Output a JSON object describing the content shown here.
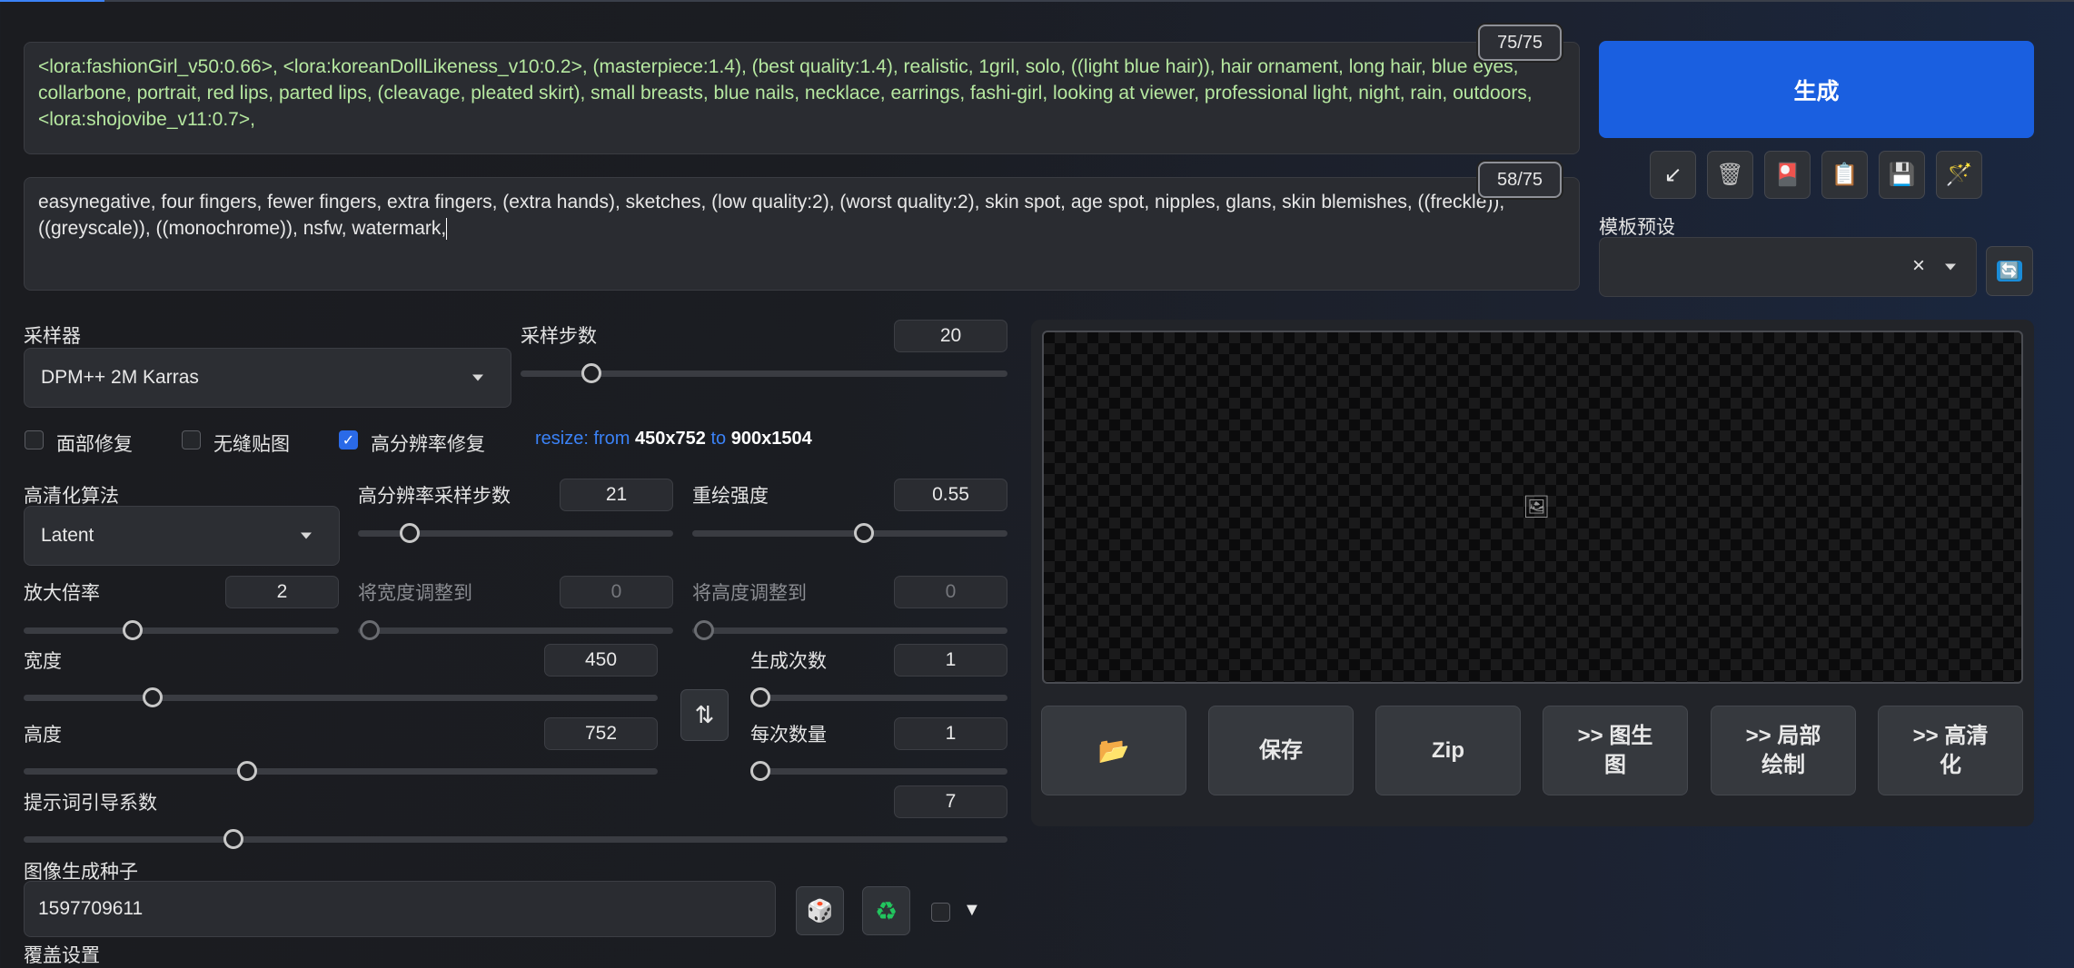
{
  "prompts": {
    "positive": "<lora:fashionGirl_v50:0.66>, <lora:koreanDollLikeness_v10:0.2>, (masterpiece:1.4), (best quality:1.4), realistic, 1gril, solo, ((light blue hair)), hair ornament, long hair, blue eyes, collarbone, portrait, red lips, parted lips, (cleavage, pleated skirt), small breasts, blue nails, necklace, earrings, fashi-girl, looking at viewer, professional light, night, rain, outdoors, <lora:shojovibe_v11:0.7>,",
    "positive_counter": "75/75",
    "negative": "easynegative, four fingers, fewer fingers, extra fingers, (extra hands), sketches, (low quality:2), (worst quality:2), skin spot, age spot, nipples, glans, skin blemishes, ((freckle)), ((greyscale)), ((monochrome)), nsfw, watermark,",
    "negative_counter": "58/75"
  },
  "generate": {
    "label": "生成",
    "tools": [
      "arrow-icon",
      "trash-icon",
      "card-icon",
      "clipboard-icon",
      "save-disk-icon",
      "magic-wand-icon"
    ],
    "tool_glyphs": [
      "↙",
      "🗑",
      "🎴",
      "📋",
      "💾",
      "🪄"
    ],
    "styles_label": "模板预设",
    "styles_clear": "×",
    "refresh_glyph": "🔄"
  },
  "sampler": {
    "label": "采样器",
    "value": "DPM++ 2M Karras",
    "steps_label": "采样步数",
    "steps": "20",
    "steps_fraction": 0.13
  },
  "options": {
    "face_restore": "面部修复",
    "tiling": "无缝贴图",
    "hires_fix": "高分辨率修复",
    "hires_checked": "✓",
    "resize_prefix": "resize: from",
    "resize_from": "450x752",
    "resize_to_word": "to",
    "resize_to": "900x1504"
  },
  "hires": {
    "upscaler_label": "高清化算法",
    "upscaler": "Latent",
    "hires_steps_label": "高分辨率采样步数",
    "hires_steps": "21",
    "hires_steps_fraction": 0.15,
    "denoise_label": "重绘强度",
    "denoise": "0.55",
    "denoise_fraction": 0.55,
    "scale_label": "放大倍率",
    "scale": "2",
    "scale_fraction": 0.35,
    "resize_w_label": "将宽度调整到",
    "resize_w": "0",
    "resize_h_label": "将高度调整到",
    "resize_h": "0"
  },
  "dims": {
    "width_label": "宽度",
    "width": "450",
    "height_label": "高度",
    "height": "752",
    "swap_glyph": "⇅",
    "batch_count_label": "生成次数",
    "batch_count": "1",
    "batch_size_label": "每次数量",
    "batch_size": "1"
  },
  "cfg": {
    "label": "提示词引导系数",
    "value": "7"
  },
  "seed": {
    "label": "图像生成种子",
    "value": "1597709611",
    "dice_glyph": "🎲",
    "recycle_glyph": "♻",
    "extra_glyph": "▼"
  },
  "bottom_cut_label": "覆盖设置",
  "output": {
    "image_icon": "🖼",
    "buttons": [
      "📂",
      "保存",
      "Zip",
      ">> 图生\n图",
      ">> 局部\n绘制",
      ">> 高清\n化"
    ]
  }
}
